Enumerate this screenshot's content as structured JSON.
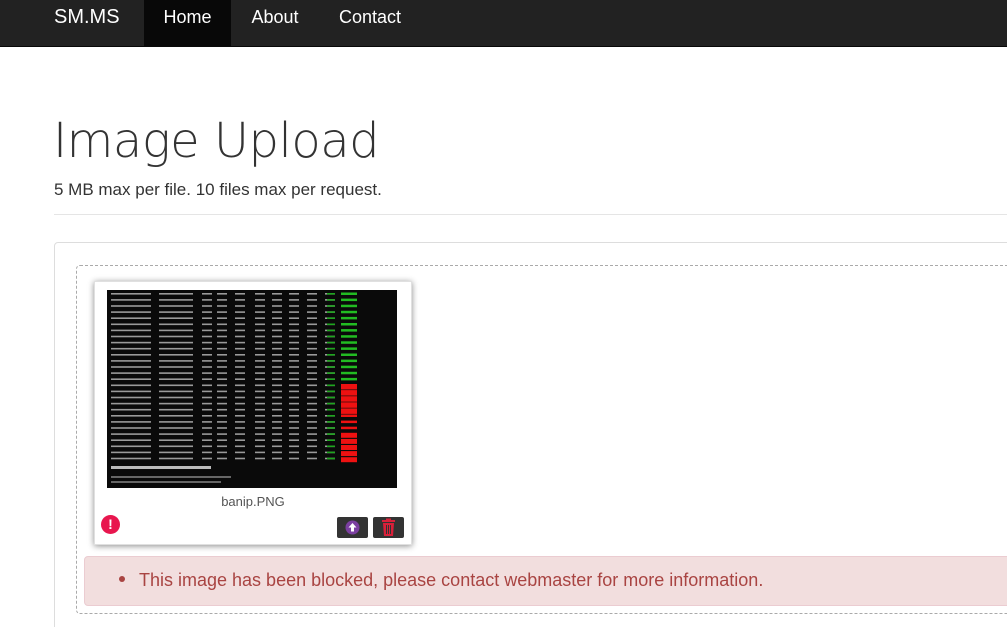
{
  "navbar": {
    "brand": "SM.MS",
    "items": [
      {
        "label": "Home",
        "active": true
      },
      {
        "label": "About",
        "active": false
      },
      {
        "label": "Contact",
        "active": false
      }
    ]
  },
  "page": {
    "title": "Image Upload",
    "subtitle": "5 MB max per file. 10 files max per request."
  },
  "upload": {
    "file": {
      "name": "banip.PNG",
      "status_icon": "exclamation-icon",
      "actions": [
        "upload-icon",
        "trash-icon"
      ]
    },
    "error_message": "This image has been blocked, please contact webmaster for more information."
  },
  "colors": {
    "navbar_bg": "#222222",
    "nav_active_bg": "#080808",
    "error_icon": "#e8164e",
    "alert_bg": "#f2dede",
    "alert_text": "#a94442",
    "upload_icon": "#7b3fa0",
    "delete_icon": "#d9203a"
  }
}
